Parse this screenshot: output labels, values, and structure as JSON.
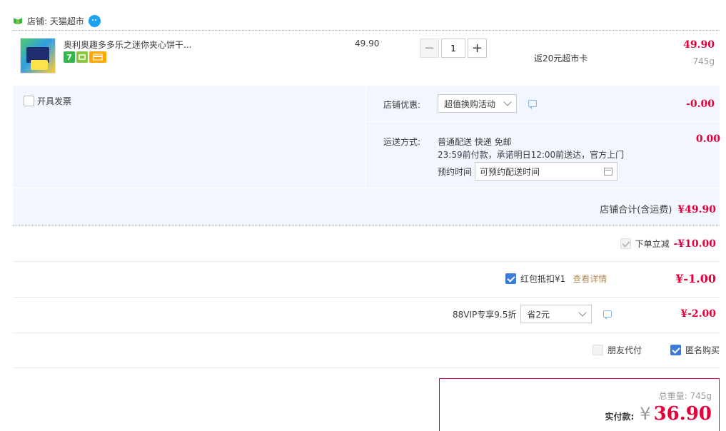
{
  "store": {
    "label": "店铺: 天猫超市",
    "wangwang_badge": "1"
  },
  "item": {
    "title": "奥利奥趣多多乐之迷你夹心饼干...",
    "unit_price": "49.90",
    "quantity": "1",
    "minus": "−",
    "plus": "+",
    "rebate": "返20元超市卡",
    "total": "49.90",
    "weight": "745g",
    "badges": [
      "7",
      "",
      ""
    ]
  },
  "options": {
    "invoice_label": "开具发票",
    "store_discount_label": "店铺优惠:",
    "store_discount_value": "超值换购活动",
    "store_discount_amount": "-0.00",
    "shipping_label": "运送方式:",
    "shipping_line1": "普通配送 快递 免邮",
    "shipping_line2": "23:59前付款，承诺明日12:00前送达，官方上门",
    "reserve_label": "预约时间",
    "reserve_value": "可预约配送时间",
    "shipping_amount": "0.00"
  },
  "store_total": {
    "label": "店铺合计(含运费)",
    "value": "¥49.90"
  },
  "discounts": {
    "instant_label": "下单立减",
    "instant_value": "-¥10.00",
    "redpacket_label": "红包抵扣¥1",
    "redpacket_link": "查看详情",
    "redpacket_value": "¥-1.00",
    "vip_label": "88VIP专享9.5折",
    "vip_select": "省2元",
    "vip_value": "¥-2.00"
  },
  "pay_options": {
    "friend_pay": "朋友代付",
    "anonymous": "匿名购买"
  },
  "summary": {
    "weight": "总重量: 745g",
    "pay_label": "实付款:",
    "currency": "¥",
    "amount": "36.90"
  },
  "colors": {
    "accent_red": "#e4003a",
    "option_bg": "#f2f7ff",
    "checkbox_blue": "#3a7bdc"
  }
}
